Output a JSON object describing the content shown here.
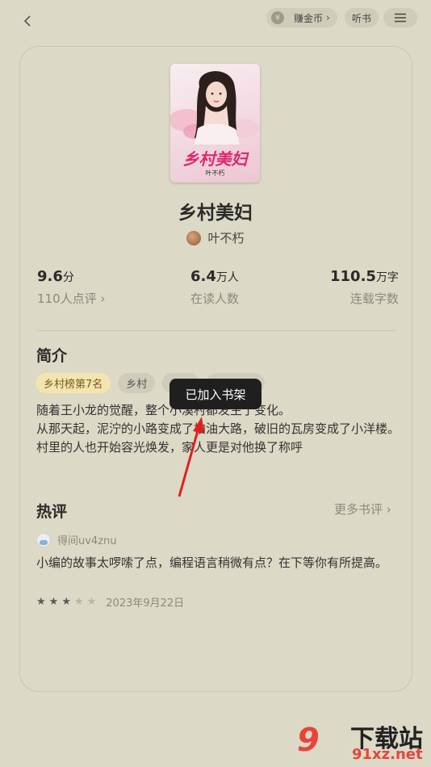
{
  "header": {
    "coins_label": "赚金币",
    "coin_symbol": "¥",
    "listen_label": "听书"
  },
  "book": {
    "cover_title": "乡村美妇",
    "cover_author": "叶不朽",
    "title": "乡村美妇",
    "author": "叶不朽"
  },
  "stats": [
    {
      "value": "9.6",
      "unit": "分",
      "label": "110人点评 ›"
    },
    {
      "value": "6.4",
      "unit": "万人",
      "label": "在读人数"
    },
    {
      "value": "110.5",
      "unit": "万字",
      "label": "连载字数"
    }
  ],
  "intro": {
    "title": "简介",
    "tags": [
      "乡村榜第7名",
      "乡村",
      "都市",
      "都市神豪"
    ],
    "synopsis": [
      "随着王小龙的觉醒，整个小溪村都发生了变化。",
      "从那天起，泥泞的小路变成了柏油大路，破旧的瓦房变成了小洋楼。",
      "村里的人也开始容光焕发，家人更是对他换了称呼"
    ]
  },
  "toast": "已加入书架",
  "hot_reviews": {
    "title": "热评",
    "more_label": "更多书评 ›",
    "reviewer": "得间uv4znu",
    "text": "小编的故事太啰嗦了点，编程语言稍微有点？在下等你有所提高。",
    "rating": 3,
    "date": "2023年9月22日"
  },
  "watermark": {
    "cn": "下载站",
    "url": "91xz.net",
    "logo": "9"
  },
  "colors": {
    "background": "#dcd9c6",
    "accent_pink": "#e0266f",
    "toast_bg": "#1f1f1f",
    "annotation_arrow": "#e02020"
  },
  "icons": {
    "back": "chevron-left-icon",
    "coin": "coin-icon",
    "menu": "hamburger-menu-icon"
  }
}
